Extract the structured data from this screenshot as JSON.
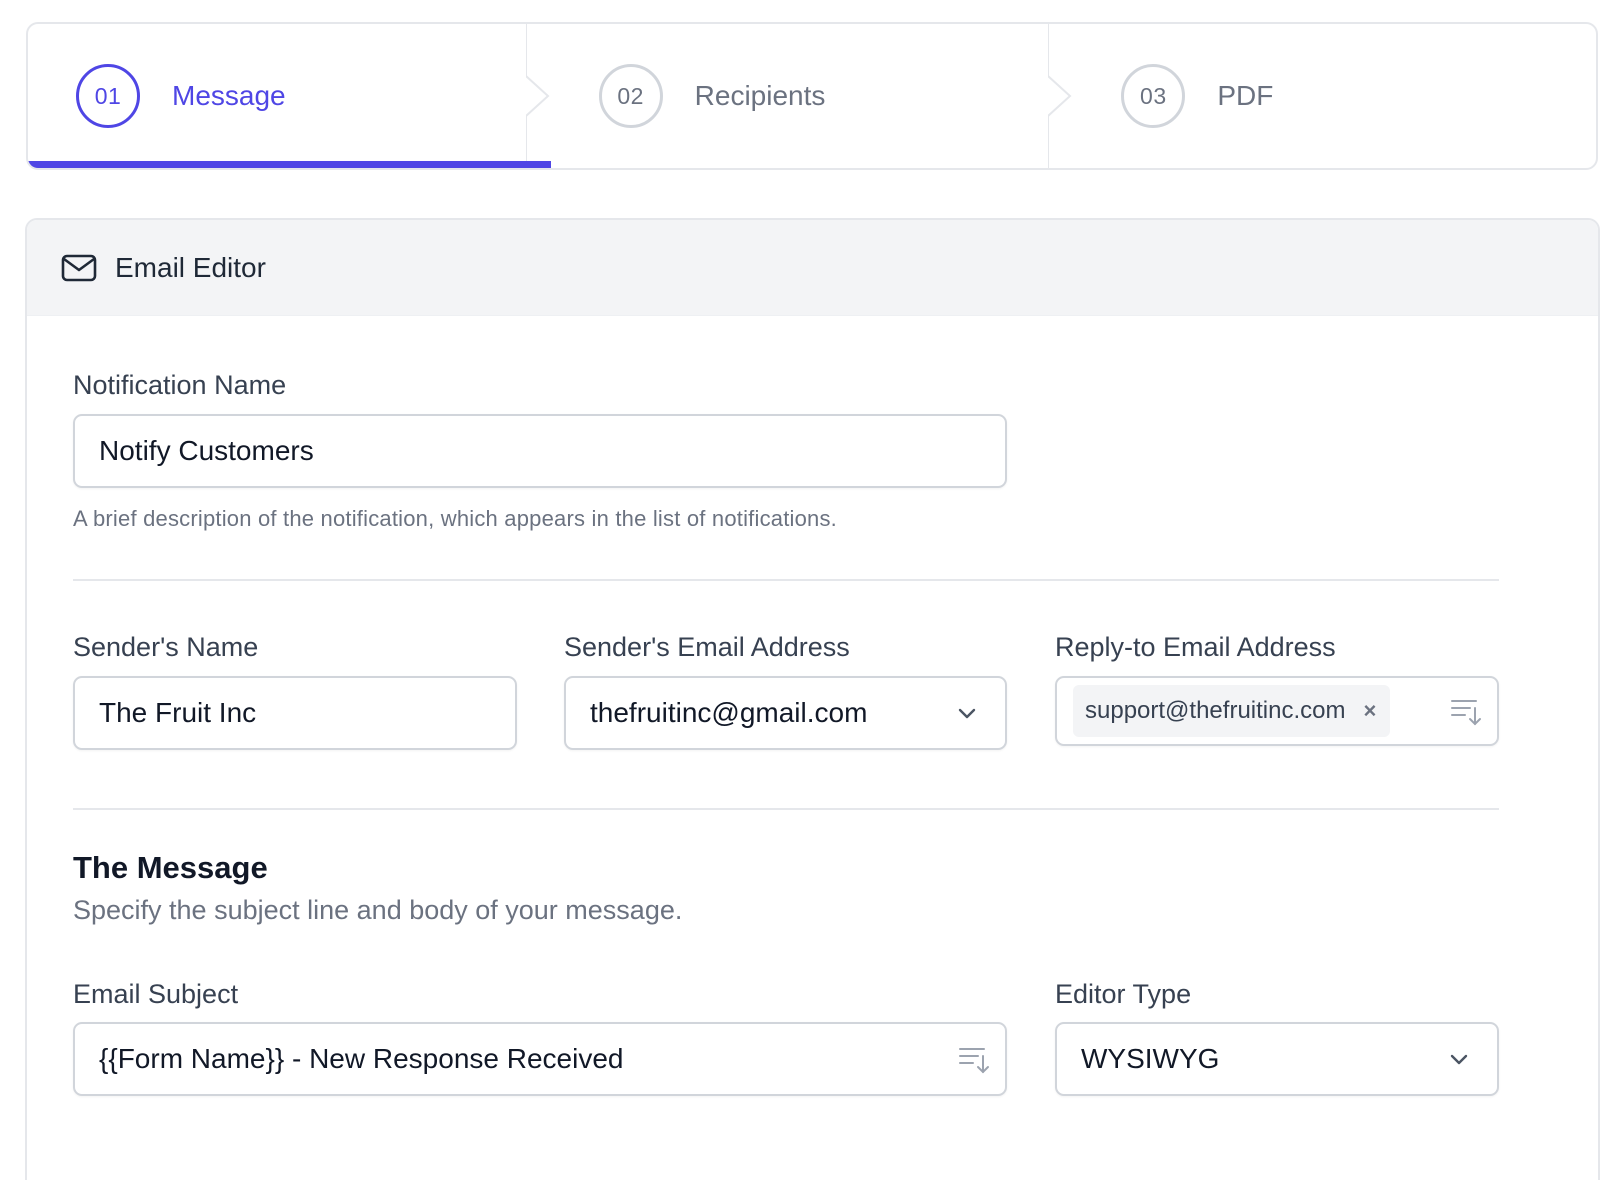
{
  "stepper": {
    "steps": [
      {
        "number": "01",
        "label": "Message",
        "active": true
      },
      {
        "number": "02",
        "label": "Recipients",
        "active": false
      },
      {
        "number": "03",
        "label": "PDF",
        "active": false
      }
    ]
  },
  "card": {
    "title": "Email Editor",
    "icon": "envelope-icon"
  },
  "form": {
    "notification_name": {
      "label": "Notification Name",
      "value": "Notify Customers",
      "help": "A brief description of the notification, which appears in the list of notifications."
    },
    "sender_name": {
      "label": "Sender's Name",
      "value": "The Fruit Inc"
    },
    "sender_email": {
      "label": "Sender's Email Address",
      "value": "thefruitinc@gmail.com"
    },
    "reply_to": {
      "label": "Reply-to Email Address",
      "tags": [
        "support@thefruitinc.com"
      ],
      "remove_glyph": "×"
    },
    "message_section": {
      "title": "The Message",
      "subtitle": "Specify the subject line and body of your message."
    },
    "email_subject": {
      "label": "Email Subject",
      "value": "{{Form Name}} - New Response Received"
    },
    "editor_type": {
      "label": "Editor Type",
      "value": "WYSIWYG"
    }
  },
  "colors": {
    "accent": "#4f46e5",
    "border": "#d1d5db",
    "muted_text": "#6b7280"
  }
}
